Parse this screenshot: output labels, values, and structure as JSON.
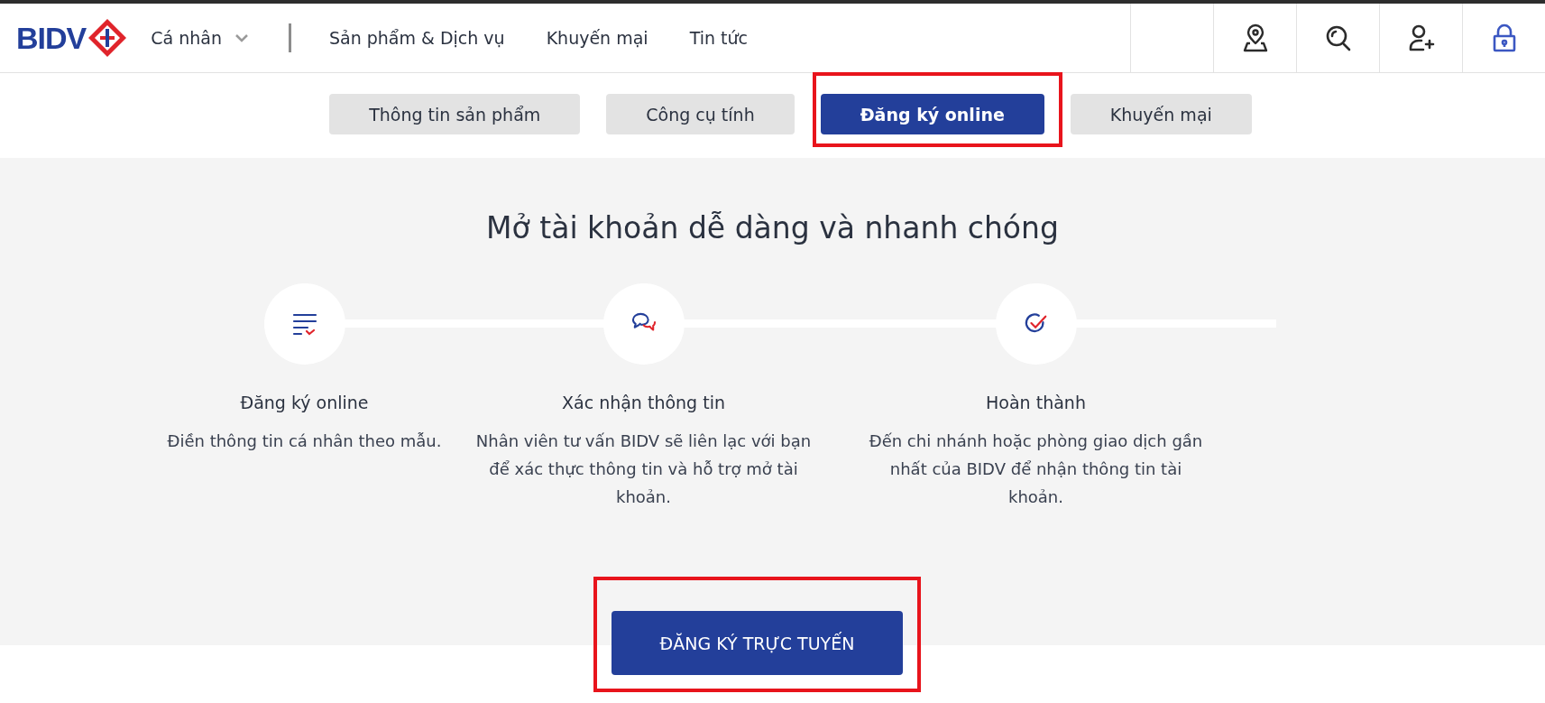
{
  "header": {
    "logo": "BIDV",
    "segment": "Cá nhân",
    "nav": [
      "Sản phẩm & Dịch vụ",
      "Khuyến mại",
      "Tin tức"
    ]
  },
  "tabs": [
    {
      "label": "Thông tin sản phẩm",
      "selected": false,
      "highlighted": false
    },
    {
      "label": "Công cụ tính",
      "selected": false,
      "highlighted": false
    },
    {
      "label": "Đăng ký online",
      "selected": true,
      "highlighted": true
    },
    {
      "label": "Khuyến mại",
      "selected": false,
      "highlighted": false
    }
  ],
  "hero": {
    "title": "Mở tài khoản dễ dàng và nhanh chóng",
    "steps": [
      {
        "kind": "form",
        "title": "Đăng ký online",
        "description": "Điền thông tin cá nhân theo mẫu."
      },
      {
        "kind": "chat",
        "title": "Xác nhận thông tin",
        "description": "Nhân viên tư vấn BIDV sẽ liên lạc với bạn để xác thực thông tin và hỗ trợ mở tài khoản."
      },
      {
        "kind": "check",
        "title": "Hoàn thành",
        "description": "Đến chi nhánh hoặc phòng giao dịch gần nhất của BIDV để nhận thông tin tài khoản."
      }
    ]
  },
  "cta": {
    "label": "ĐĂNG KÝ TRỰC TUYẾN",
    "highlighted": true
  }
}
